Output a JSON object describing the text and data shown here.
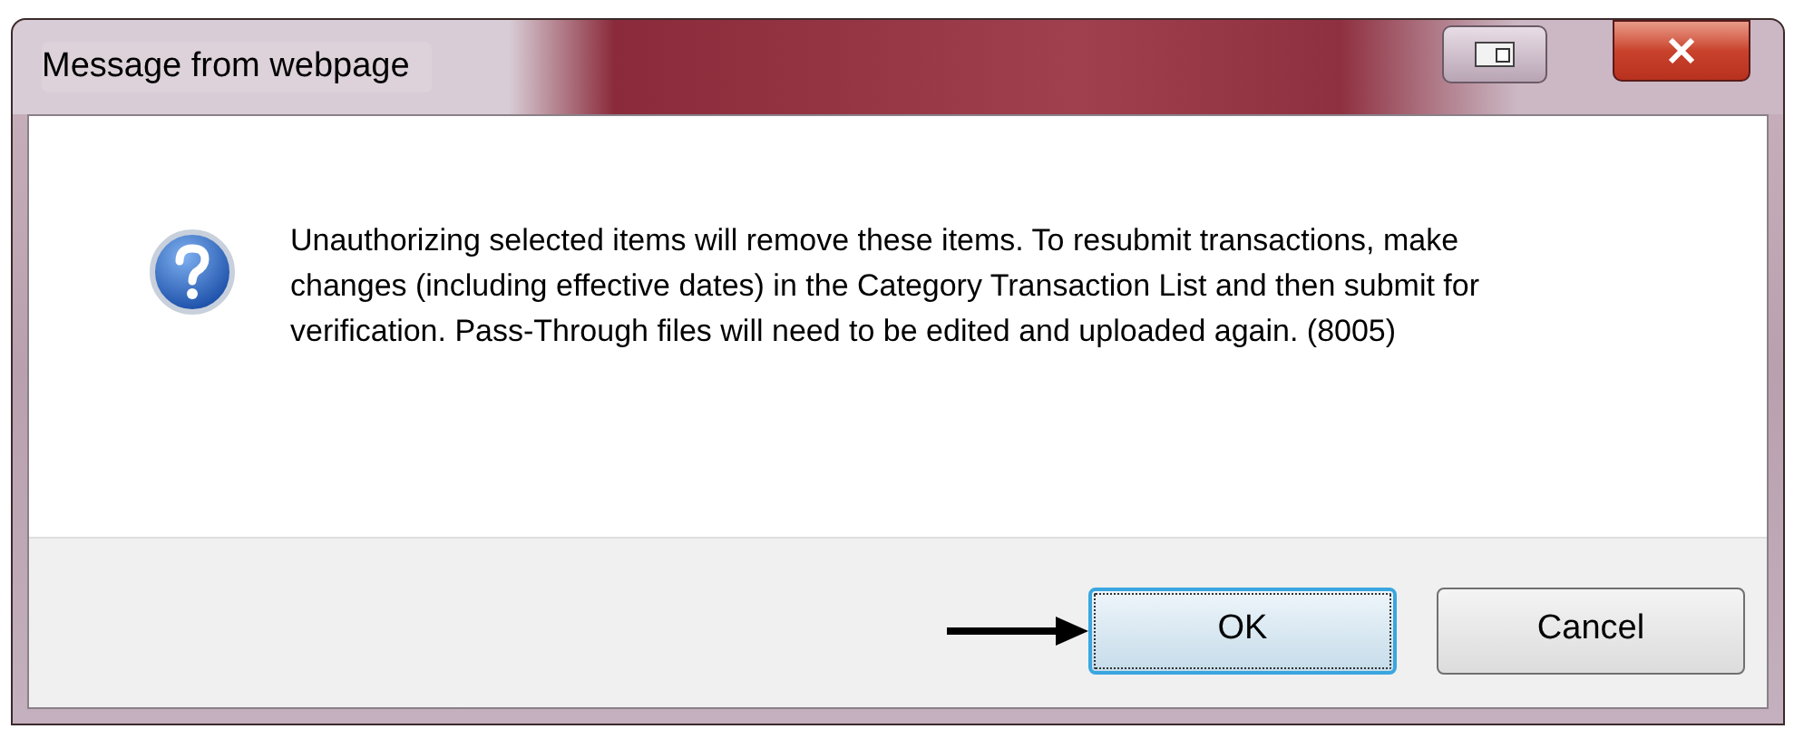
{
  "window": {
    "title": "Message from webpage"
  },
  "message": {
    "text": "Unauthorizing selected items will remove these items. To resubmit transactions, make changes (including effective dates) in the Category Transaction List and then submit for verification. Pass-Through files will need to be edited and uploaded again. (8005)"
  },
  "buttons": [
    {
      "label": "OK",
      "focused": true
    },
    {
      "label": "Cancel",
      "focused": false
    }
  ]
}
